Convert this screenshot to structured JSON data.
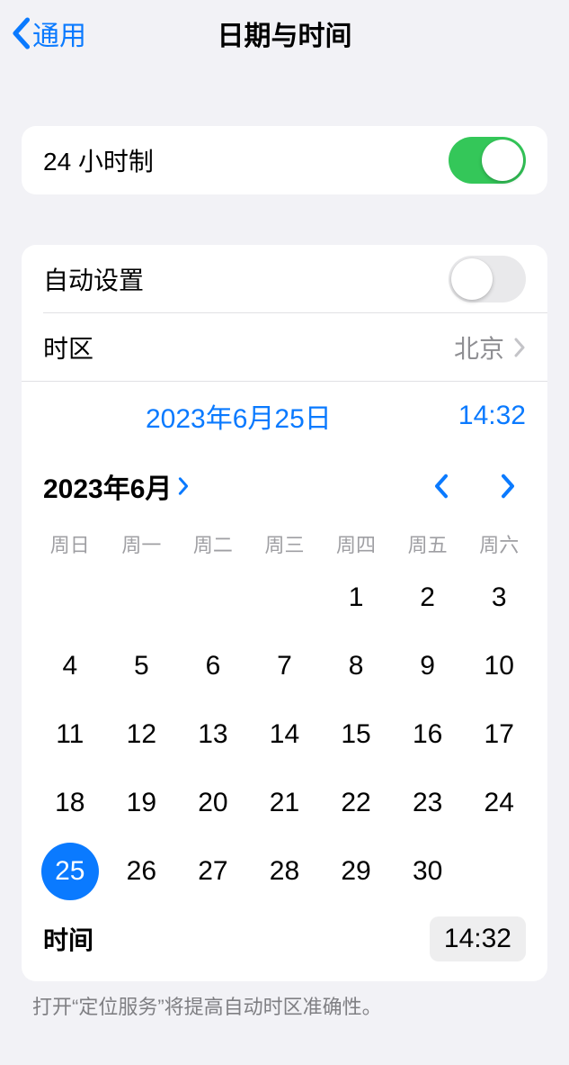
{
  "header": {
    "back_label": "通用",
    "title": "日期与时间"
  },
  "settings": {
    "twenty_four_hour": {
      "label": "24 小时制",
      "on": true
    },
    "auto_set": {
      "label": "自动设置",
      "on": false
    },
    "timezone": {
      "label": "时区",
      "value": "北京"
    },
    "date_button": "2023年6月25日",
    "time_button": "14:32"
  },
  "calendar": {
    "month_label": "2023年6月",
    "weekdays": [
      "周日",
      "周一",
      "周二",
      "周三",
      "周四",
      "周五",
      "周六"
    ],
    "weeks": [
      [
        "",
        "",
        "",
        "",
        "1",
        "2",
        "3"
      ],
      [
        "4",
        "5",
        "6",
        "7",
        "8",
        "9",
        "10"
      ],
      [
        "11",
        "12",
        "13",
        "14",
        "15",
        "16",
        "17"
      ],
      [
        "18",
        "19",
        "20",
        "21",
        "22",
        "23",
        "24"
      ],
      [
        "25",
        "26",
        "27",
        "28",
        "29",
        "30",
        ""
      ]
    ],
    "selected_day": "25",
    "time_label": "时间",
    "time_value": "14:32"
  },
  "footer_note": "打开“定位服务”将提高自动时区准确性。"
}
